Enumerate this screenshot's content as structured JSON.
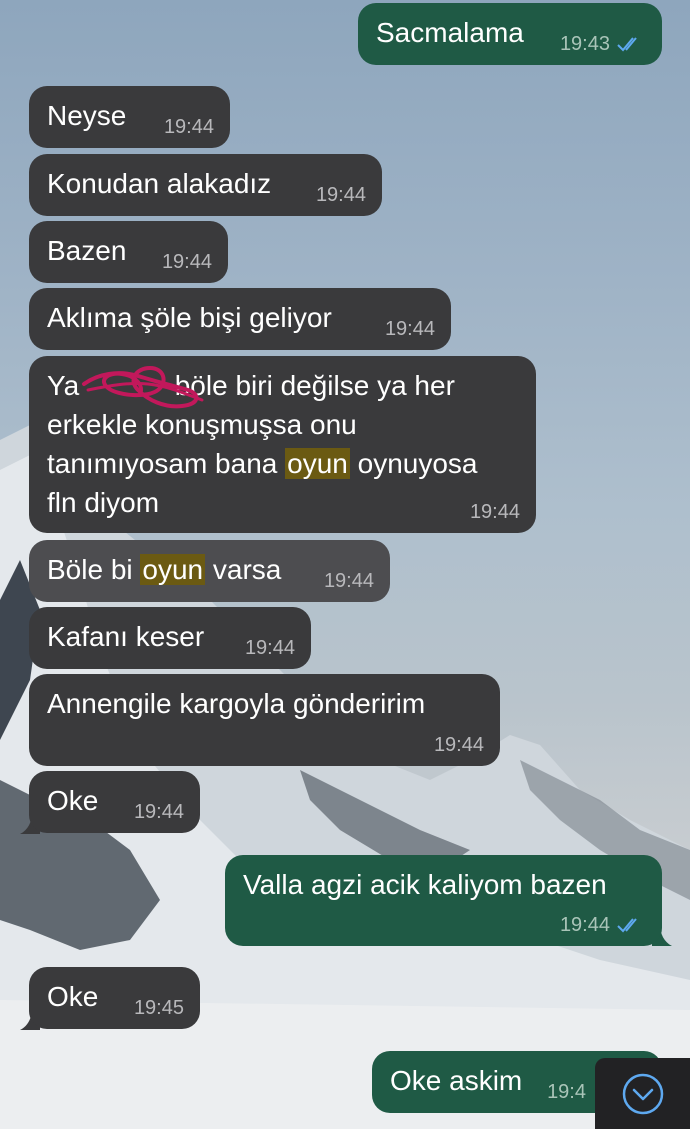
{
  "messages": [
    {
      "text": "Sacmalama",
      "time": "19:43",
      "side": "out"
    },
    {
      "text": "Neyse",
      "time": "19:44",
      "side": "in"
    },
    {
      "text": "Konudan alakadız",
      "time": "19:44",
      "side": "in"
    },
    {
      "text": "Bazen",
      "time": "19:44",
      "side": "in"
    },
    {
      "text": "Aklıma şöle bişi geliyor",
      "time": "19:44",
      "side": "in"
    },
    {
      "line1_before": "Ya ",
      "line1_after": " böle biri değilse ya her",
      "line2": "erkekle konuşmuşsa onu",
      "line3_before": "tanımıyosam bana ",
      "line3_highlight": "oyun",
      "line3_after": " oynuyosa",
      "line4": "fln diyom",
      "time": "19:44",
      "side": "in"
    },
    {
      "before": "Böle bi ",
      "highlight": "oyun",
      "after": " varsa",
      "time": "19:44",
      "side": "in"
    },
    {
      "text": "Kafanı keser",
      "time": "19:44",
      "side": "in"
    },
    {
      "text": "Annengile kargoyla gönderirim",
      "time": "19:44",
      "side": "in"
    },
    {
      "text": "Oke",
      "time": "19:44",
      "side": "in"
    },
    {
      "text": "Valla agzi acik kaliyom bazen",
      "time": "19:44",
      "side": "out"
    },
    {
      "text": "Oke",
      "time": "19:45",
      "side": "in"
    },
    {
      "text": "Oke askim",
      "time": "19:4",
      "side": "out"
    }
  ],
  "colors": {
    "incoming_bubble": "#3a3a3c",
    "outgoing_bubble": "#1f5a45",
    "read_checks": "#5ea9f0",
    "highlight": "#6b5a12",
    "scribble": "#c2185b"
  },
  "icons": {
    "read_receipt": "double-check-icon",
    "scroll_down": "chevron-down-circle-icon"
  }
}
